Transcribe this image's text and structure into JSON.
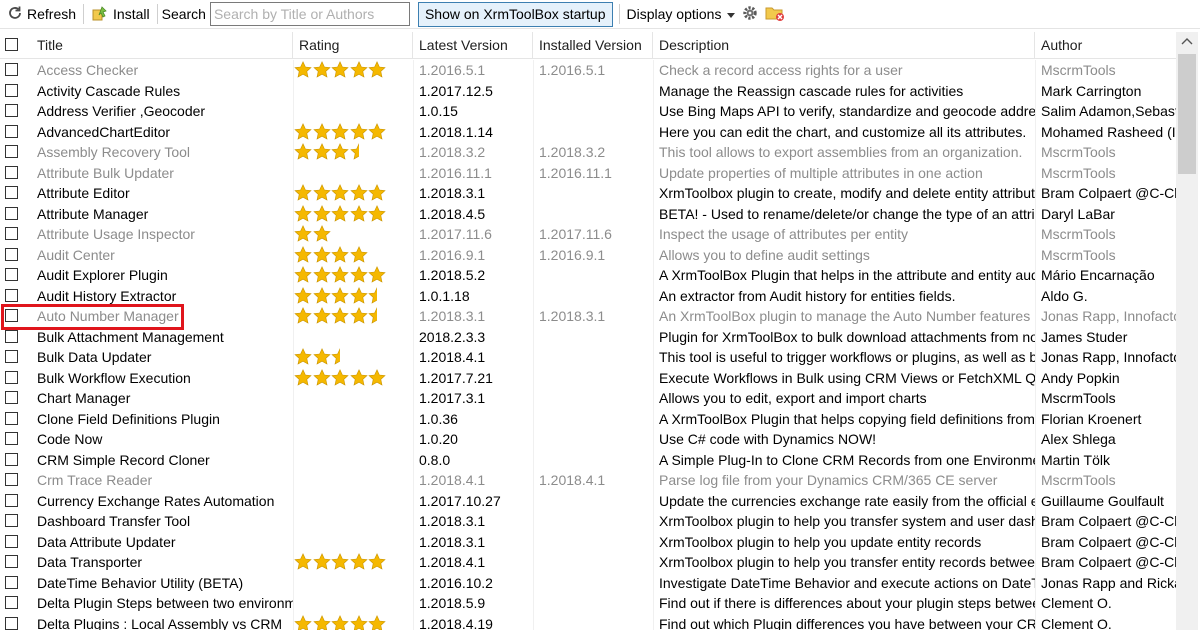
{
  "toolbar": {
    "refresh_label": "Refresh",
    "install_label": "Install",
    "search_label": "Search",
    "search_placeholder": "Search by Title or Authors",
    "startup_label": "Show on XrmToolBox startup",
    "display_options_label": "Display options",
    "display_options_icon": "chevron-down-icon",
    "settings_icon": "gear-icon",
    "folder_icon": "folder-cleanup-icon"
  },
  "columns": [
    "Title",
    "Rating",
    "Latest Version",
    "Installed Version",
    "Description",
    "Author"
  ],
  "colors": {
    "star": "#f5b800",
    "installed_text": "#8c8c8c",
    "highlight": "#e0151c"
  },
  "highlighted_row": "Auto Number Manager",
  "rows": [
    {
      "title": "Access Checker",
      "rating": 5,
      "latest": "1.2016.5.1",
      "installed": "1.2016.5.1",
      "description": "Check a record access rights for a user",
      "author": "MscrmTools"
    },
    {
      "title": "Activity Cascade Rules",
      "rating": 0,
      "latest": "1.2017.12.5",
      "installed": "",
      "description": "Manage the Reassign cascade rules for activities",
      "author": "Mark Carrington"
    },
    {
      "title": "Address Verifier ,Geocoder",
      "rating": 0,
      "latest": "1.0.15",
      "installed": "",
      "description": "Use Bing Maps API to verify, standardize and geocode addres...",
      "author": "Salim Adamon,Sebastie"
    },
    {
      "title": "AdvancedChartEditor",
      "rating": 5,
      "latest": "1.2018.1.14",
      "installed": "",
      "description": "Here you can edit the chart, and customize all its attributes.",
      "author": "Mohamed Rasheed (IT."
    },
    {
      "title": "Assembly Recovery Tool",
      "rating": 3.5,
      "latest": "1.2018.3.2",
      "installed": "1.2018.3.2",
      "description": "This tool allows to export assemblies from an organization.",
      "author": "MscrmTools"
    },
    {
      "title": "Attribute Bulk Updater",
      "rating": 0,
      "latest": "1.2016.11.1",
      "installed": "1.2016.11.1",
      "description": "Update properties of multiple attributes in one action",
      "author": "MscrmTools"
    },
    {
      "title": "Attribute Editor",
      "rating": 5,
      "latest": "1.2018.3.1",
      "installed": "",
      "description": "XrmToolbox plugin to create, modify and delete entity attribute ...",
      "author": "Bram Colpaert @C-Clea"
    },
    {
      "title": "Attribute Manager",
      "rating": 5,
      "latest": "1.2018.4.5",
      "installed": "",
      "description": "BETA! - Used to rename/delete/or change the type of an attrib...",
      "author": "Daryl LaBar"
    },
    {
      "title": "Attribute Usage Inspector",
      "rating": 2,
      "latest": "1.2017.11.6",
      "installed": "1.2017.11.6",
      "description": "Inspect the usage of attributes per entity",
      "author": "MscrmTools"
    },
    {
      "title": "Audit Center",
      "rating": 4,
      "latest": "1.2016.9.1",
      "installed": "1.2016.9.1",
      "description": "Allows you to define audit settings",
      "author": "MscrmTools"
    },
    {
      "title": "Audit Explorer Plugin",
      "rating": 5,
      "latest": "1.2018.5.2",
      "installed": "",
      "description": "A XrmToolBox Plugin that helps in the attribute and entity audit ...",
      "author": "Mário Encarnação"
    },
    {
      "title": "Audit History Extractor",
      "rating": 4.5,
      "latest": "1.0.1.18",
      "installed": "",
      "description": "An extractor from Audit history for entities fields.",
      "author": "Aldo G."
    },
    {
      "title": "Auto Number Manager",
      "rating": 4.5,
      "latest": "1.2018.3.1",
      "installed": "1.2018.3.1",
      "description": "An XrmToolBox plugin to manage the Auto Number features int...",
      "author": "Jonas Rapp, Innofactor"
    },
    {
      "title": "Bulk Attachment Management",
      "rating": 0,
      "latest": "2018.2.3.3",
      "installed": "",
      "description": "Plugin for XrmToolBox to bulk download attachments from note...",
      "author": "James Studer"
    },
    {
      "title": "Bulk Data Updater",
      "rating": 2.5,
      "latest": "1.2018.4.1",
      "installed": "",
      "description": "This tool is useful to trigger workflows or plugins, as well as bul...",
      "author": "Jonas Rapp, Innofactor"
    },
    {
      "title": "Bulk Workflow Execution",
      "rating": 5,
      "latest": "1.2017.7.21",
      "installed": "",
      "description": "Execute Workflows in Bulk using CRM Views or FetchXML Qu...",
      "author": "Andy Popkin"
    },
    {
      "title": "Chart Manager",
      "rating": 0,
      "latest": "1.2017.3.1",
      "installed": "",
      "description": "Allows you to edit, export and import charts",
      "author": "MscrmTools"
    },
    {
      "title": "Clone Field Definitions Plugin",
      "rating": 0,
      "latest": "1.0.36",
      "installed": "",
      "description": "A XrmToolBox Plugin that helps copying field definitions from a...",
      "author": "Florian Kroenert"
    },
    {
      "title": "Code Now",
      "rating": 0,
      "latest": "1.0.20",
      "installed": "",
      "description": "Use C# code with Dynamics NOW!",
      "author": "Alex Shlega"
    },
    {
      "title": "CRM Simple Record Cloner",
      "rating": 0,
      "latest": "0.8.0",
      "installed": "",
      "description": "A Simple Plug-In to Clone CRM Records from one Environment...",
      "author": "Martin Tölk"
    },
    {
      "title": "Crm Trace Reader",
      "rating": 0,
      "latest": "1.2018.4.1",
      "installed": "1.2018.4.1",
      "description": "Parse log file from your Dynamics CRM/365 CE server",
      "author": "MscrmTools"
    },
    {
      "title": "Currency Exchange Rates Automation",
      "rating": 0,
      "latest": "1.2017.10.27",
      "installed": "",
      "description": "Update the currencies exchange rate easily from the official ex...",
      "author": "Guillaume Goulfault"
    },
    {
      "title": "Dashboard Transfer Tool",
      "rating": 0,
      "latest": "1.2018.3.1",
      "installed": "",
      "description": "XrmToolbox plugin to help you transfer system and user dashbo...",
      "author": "Bram Colpaert @C-Clea"
    },
    {
      "title": "Data Attribute Updater",
      "rating": 0,
      "latest": "1.2018.3.1",
      "installed": "",
      "description": "XrmToolbox plugin to help you update entity records",
      "author": "Bram Colpaert @C-Clea"
    },
    {
      "title": "Data Transporter",
      "rating": 5,
      "latest": "1.2018.4.1",
      "installed": "",
      "description": "XrmToolbox plugin to help you transfer entity records between ...",
      "author": "Bram Colpaert @C-Clea"
    },
    {
      "title": "DateTime Behavior Utility (BETA)",
      "rating": 0,
      "latest": "1.2016.10.2",
      "installed": "",
      "description": "Investigate DateTime Behavior and execute actions on DateTi...",
      "author": "Jonas Rapp and Rickar"
    },
    {
      "title": "Delta Plugin Steps between two environm...",
      "rating": 0,
      "latest": "1.2018.5.9",
      "installed": "",
      "description": "Find out if there is differences about your plugin steps between ...",
      "author": "Clement O."
    },
    {
      "title": "Delta Plugins : Local Assembly vs CRM",
      "rating": 5,
      "latest": "1.2018.4.19",
      "installed": "",
      "description": "Find out which Plugin differences you have between your CRM...",
      "author": "Clement O."
    }
  ]
}
